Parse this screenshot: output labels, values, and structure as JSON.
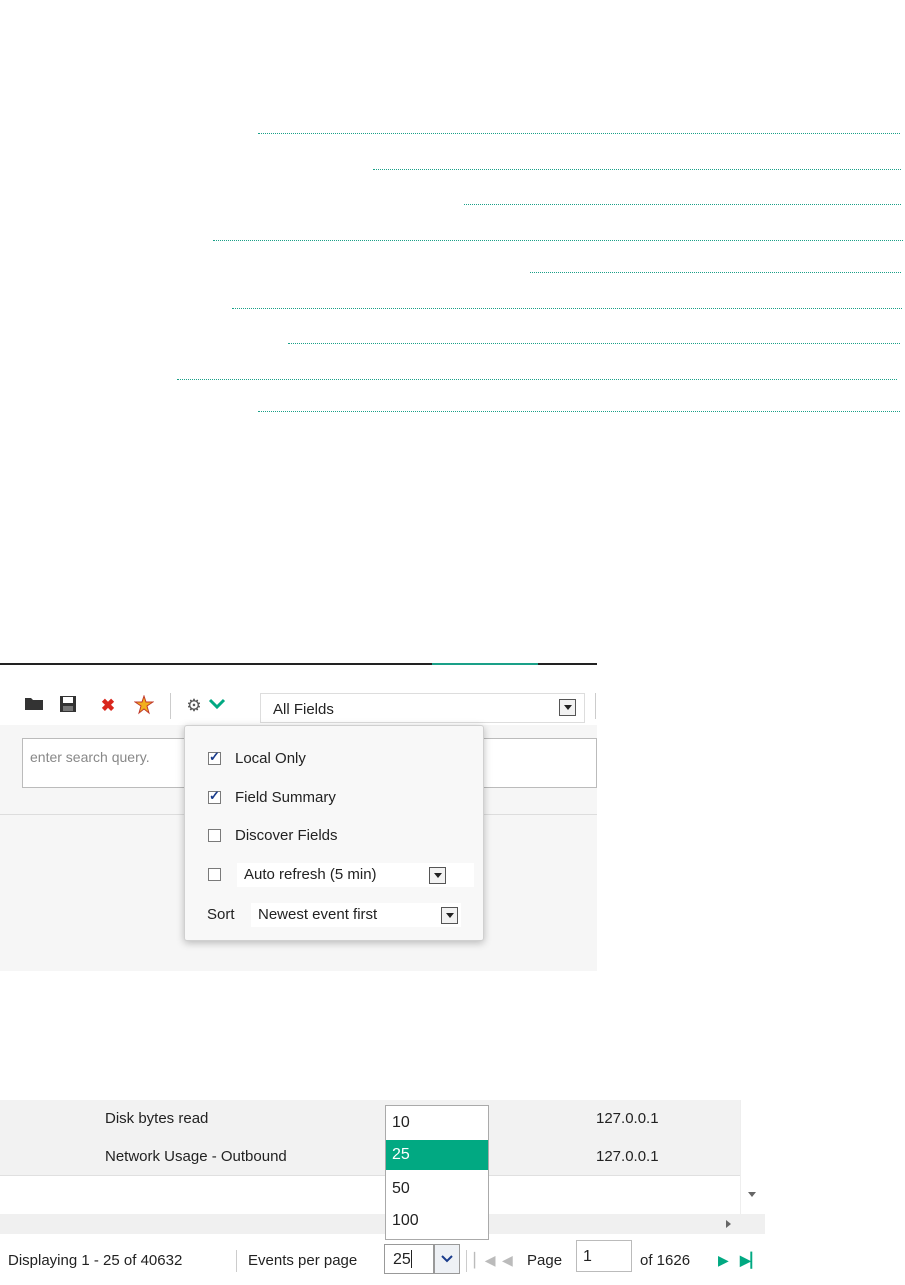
{
  "toolbar": {
    "icons": [
      "folder-icon",
      "save-icon",
      "delete-icon",
      "wand-icon",
      "gear-icon",
      "chevron-down-icon"
    ],
    "field_select": "All Fields",
    "search_placeholder": "enter search query."
  },
  "settings_popup": {
    "local_only": {
      "label": "Local Only",
      "checked": true
    },
    "field_summary": {
      "label": "Field Summary",
      "checked": true
    },
    "discover_fields": {
      "label": "Discover Fields",
      "checked": false
    },
    "auto_refresh": {
      "label": "Auto refresh (5 min)",
      "checked": false
    },
    "sort_label": "Sort",
    "sort_value": "Newest event first"
  },
  "grid": {
    "rows": [
      {
        "name": "Disk bytes read",
        "ip": "127.0.0.1"
      },
      {
        "name": "Network Usage - Outbound",
        "ip": "127.0.0.1"
      }
    ]
  },
  "pager": {
    "displaying": "Displaying 1 - 25 of 40632",
    "events_per_page_label": "Events per page",
    "events_per_page_value": "25",
    "page_label": "Page",
    "page_value": "1",
    "of_pages": "of 1626"
  },
  "per_page_options": [
    "10",
    "25",
    "50",
    "100"
  ],
  "per_page_selected": "25",
  "colors": {
    "accent": "#01a982",
    "delete": "#d9261c"
  }
}
